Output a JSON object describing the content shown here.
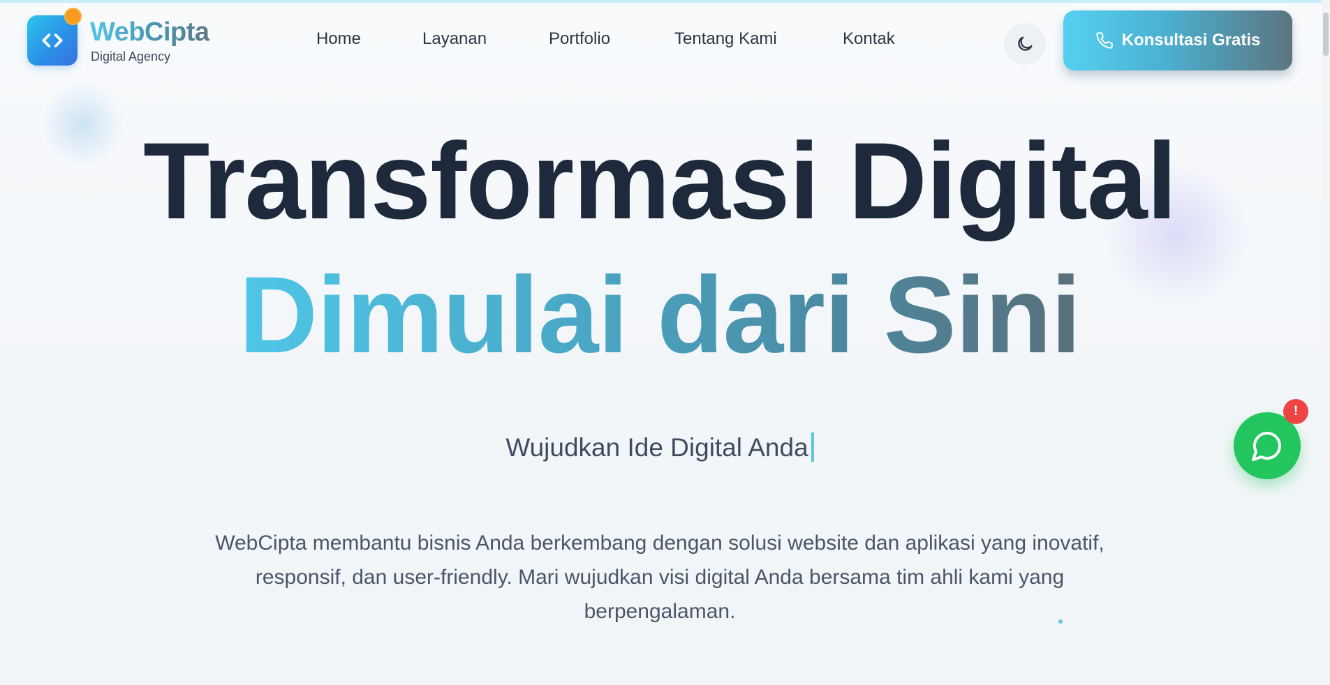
{
  "brand": {
    "name": "WebCipta",
    "tagline": "Digital Agency",
    "logo_icon": "code-brackets-icon"
  },
  "nav": {
    "items": [
      {
        "label": "Home"
      },
      {
        "label": "Layanan"
      },
      {
        "label": "Portfolio"
      },
      {
        "label": "Tentang Kami"
      },
      {
        "label": "Kontak"
      }
    ]
  },
  "header": {
    "theme_toggle_icon": "moon-icon",
    "cta": {
      "label": "Konsultasi Gratis",
      "icon": "phone-icon"
    }
  },
  "hero": {
    "title_line1": "Transformasi Digital",
    "title_line2": "Dimulai dari Sini",
    "typed_text": "Wujudkan Ide Digital Anda",
    "description": "WebCipta membantu bisnis Anda berkembang dengan solusi website dan aplikasi yang inovatif, responsif, dan user-friendly. Mari wujudkan visi digital Anda bersama tim ahli kami yang berpengalaman."
  },
  "chat": {
    "icon": "chat-bubble-icon",
    "badge": "!"
  },
  "colors": {
    "accent_cyan": "#4fc6e8",
    "accent_slate": "#5a6f7b",
    "heading_dark": "#1e293b",
    "chat_green": "#22c55e",
    "badge_red": "#ef4444",
    "logo_orange": "#f79a1d"
  }
}
